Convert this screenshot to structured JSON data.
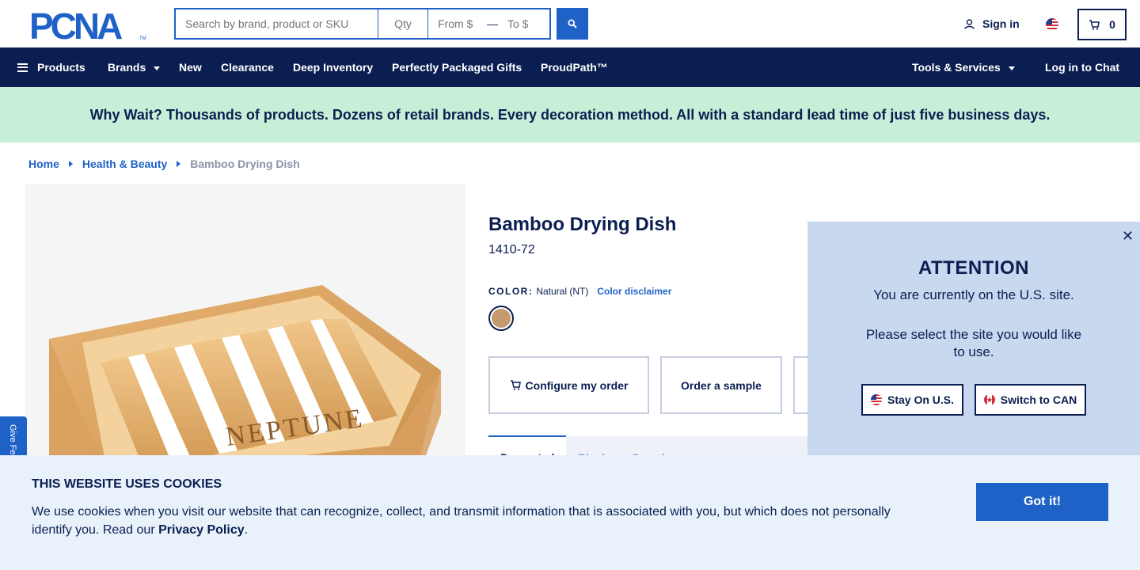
{
  "header": {
    "logo_text": "PCNA",
    "search": {
      "placeholder": "Search by brand, product or SKU"
    },
    "qty": {
      "placeholder": "Qty"
    },
    "price_from": {
      "placeholder": "From $"
    },
    "price_to": {
      "placeholder": "To $"
    },
    "sign_in": "Sign in",
    "cart_count": "0"
  },
  "nav": {
    "items": [
      "Products",
      "Brands",
      "New",
      "Clearance",
      "Deep Inventory",
      "Perfectly Packaged Gifts",
      "ProudPath™"
    ],
    "tools": "Tools & Services",
    "chat": "Log in to Chat"
  },
  "promo": "Why Wait? Thousands of products. Dozens of retail brands. Every decoration method. All with a standard lead time of just five business days.",
  "breadcrumb": [
    "Home",
    "Health & Beauty",
    "Bamboo Drying Dish"
  ],
  "product": {
    "title": "Bamboo Drying Dish",
    "sku": "1410-72",
    "color_label": "COLOR:",
    "color_value": "Natural (NT)",
    "color_disclaimer": "Color disclaimer",
    "swatch_color": "#c59a6e",
    "actions": [
      "Configure my order",
      "Order a sample"
    ],
    "tabs": [
      "Decorated",
      "Blank",
      "Sample"
    ],
    "image_engraving": "NEPTUNE"
  },
  "feedback": "Give Feedback",
  "attention": {
    "title": "ATTENTION",
    "line1": "You are currently on the U.S. site.",
    "line2": "Please select the site you would like to use.",
    "stay": "Stay On U.S.",
    "switch": "Switch to CAN"
  },
  "cookie": {
    "title": "THIS WEBSITE USES COOKIES",
    "text": "We use cookies when you visit our website that can recognize, collect, and transmit information that is associated with you, but which does not personally identify you. Read our ",
    "link": "Privacy Policy",
    "end": ".",
    "button": "Got it!"
  },
  "colors": {
    "navy": "#0b1e51",
    "blue": "#1f62c7",
    "promo_bg": "#c7efd7",
    "panel_bg": "#c8d8ef",
    "cookie_bg": "#e9f1fb"
  }
}
